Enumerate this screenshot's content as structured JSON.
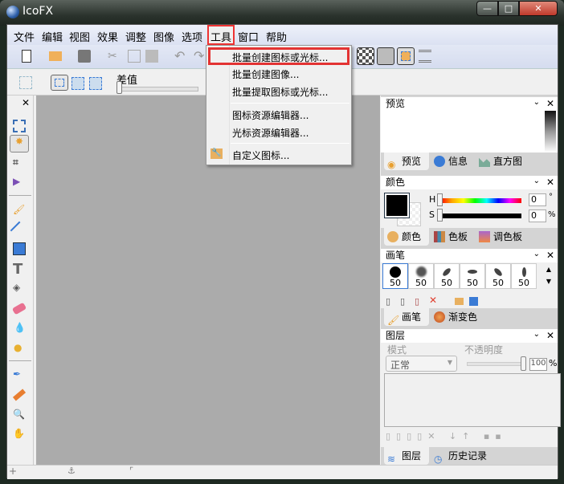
{
  "window": {
    "title": "IcoFX",
    "minimize": "—",
    "maximize": "□",
    "close": "✕"
  },
  "menu": [
    "文件",
    "编辑",
    "视图",
    "效果",
    "调整",
    "图像",
    "选项",
    "工具",
    "窗口",
    "帮助"
  ],
  "toolbar2": {
    "tolerance_label": "差值"
  },
  "dropdown": {
    "items": [
      "批量创建图标或光标...",
      "批量创建图像...",
      "批量提取图标或光标...",
      "图标资源编辑器...",
      "光标资源编辑器...",
      "自定义图标..."
    ]
  },
  "preview": {
    "title": "预览",
    "tabs": [
      "预览",
      "信息",
      "直方图"
    ]
  },
  "color": {
    "title": "颜色",
    "h_label": "H",
    "s_label": "S",
    "h_value": "0",
    "s_value": "0",
    "h_unit": "°",
    "s_unit": "%",
    "tabs": [
      "颜色",
      "色板",
      "调色板"
    ]
  },
  "brush": {
    "title": "画笔",
    "sizes": [
      "50",
      "50",
      "50",
      "50",
      "50",
      "50"
    ],
    "tabs": [
      "画笔",
      "渐变色"
    ]
  },
  "layers": {
    "title": "图层",
    "mode_label": "模式",
    "mode_value": "正常",
    "opacity_label": "不透明度",
    "opacity_value": "100",
    "opacity_unit": "%",
    "tabs": [
      "图层",
      "历史记录"
    ]
  },
  "colors": {
    "highlight": "#e33333",
    "canvas": "#ababab"
  }
}
